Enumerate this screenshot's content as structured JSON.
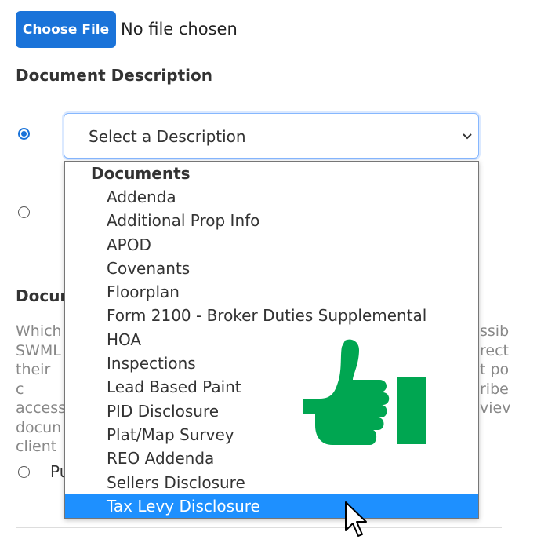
{
  "file_input": {
    "button_label": "Choose File",
    "status": "No file chosen"
  },
  "document_description": {
    "label": "Document Description",
    "select_placeholder": "Select a Description",
    "dropdown": {
      "group_label": "Documents",
      "options": [
        "Addenda",
        "Additional Prop Info",
        "APOD",
        "Covenants",
        "Floorplan",
        "Form 2100 - Broker Duties Supplemental",
        "HOA",
        "Inspections",
        "Lead Based Paint",
        "PID Disclosure",
        "Plat/Map Survey",
        "REO Addenda",
        "Sellers Disclosure",
        "Tax Levy Disclosure"
      ],
      "highlighted": "Tax Levy Disclosure"
    }
  },
  "partial_section": {
    "heading_fragment": "Docur",
    "left_fragments": [
      "Which",
      "SWML",
      "their c",
      "access",
      "docun",
      "client"
    ],
    "right_fragments": [
      "ssib",
      "rect",
      "t po",
      "ribe",
      "viev",
      ""
    ],
    "radio_label_fragment": "Pu"
  },
  "colors": {
    "accent": "#1a73d9",
    "highlight": "#1e90ff",
    "thumb": "#00a651"
  },
  "icons": {
    "thumb": "thumbs-up-icon",
    "cursor": "mouse-pointer-icon",
    "chevron": "chevron-down-icon"
  }
}
